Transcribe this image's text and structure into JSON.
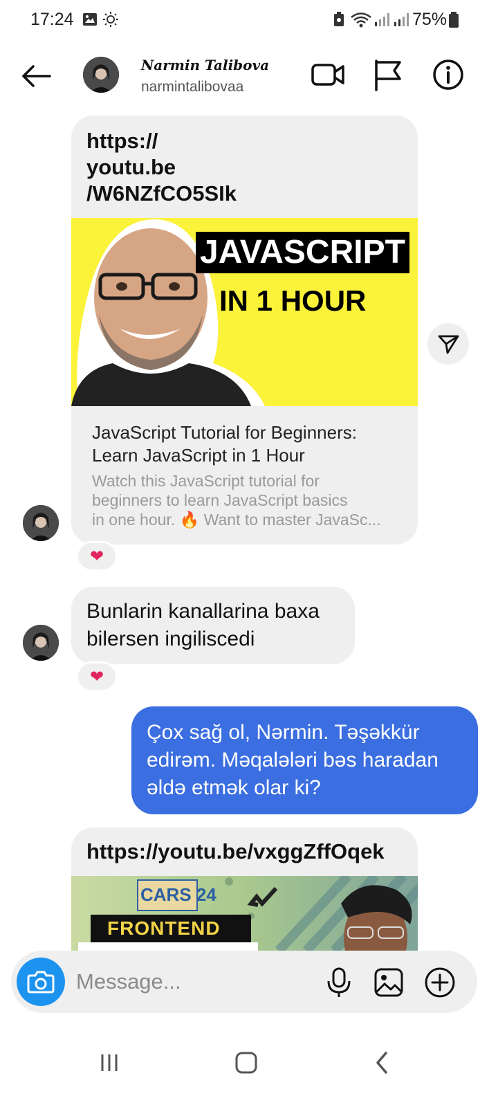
{
  "status_bar": {
    "time": "17:24",
    "battery": "75%"
  },
  "header": {
    "display_name": "Narmin Talibova",
    "username": "narmintalibovaa"
  },
  "messages": [
    {
      "type": "link",
      "url": "https://\nyoutu.be\n/W6NZfCO5SIk",
      "thumbnail_title": "JAVASCRIPT",
      "thumbnail_subtitle": "IN 1 HOUR",
      "title": "JavaScript Tutorial for Beginners: Learn JavaScript in 1 Hour",
      "description_line1": "Watch this JavaScript tutorial for",
      "description_line2": "beginners to learn JavaScript basics",
      "description_line3": "in one hour. 🔥 Want to master JavaSc...",
      "reaction": "❤"
    },
    {
      "type": "text",
      "text": "Bunlarin kanallarina baxa bilersen ingiliscedi",
      "reaction": "❤"
    },
    {
      "type": "text-out",
      "text": "Çox sağ ol, Nərmin. Təşəkkür edirəm. Məqalələri bəs haradan əldə etmək olar ki?"
    },
    {
      "type": "link",
      "url": "https://youtu.be/vxggZffOqek",
      "thumbnail_brand": "CARS 24",
      "thumbnail_label": "FRONTEND"
    }
  ],
  "composer": {
    "placeholder": "Message..."
  },
  "colors": {
    "accent_blue": "#3b6ee0",
    "camera_blue": "#1d93f0",
    "bubble_grey": "#efefef",
    "heart_red": "#e0245e"
  }
}
